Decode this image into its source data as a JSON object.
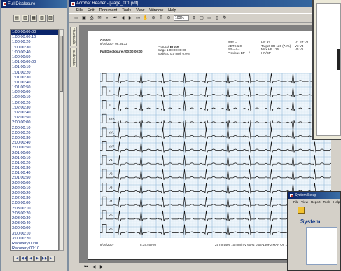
{
  "left_window": {
    "title": "Full Disclosure",
    "times": [
      "1:00:00:00:00",
      "1:00:00:00:10",
      "1:00:00:20",
      "1:00:00:30",
      "1:00:00:40",
      "1:00:00:50",
      "1:01:00:00:00",
      "1:01:00:10",
      "1:01:00:20",
      "1:01:00:30",
      "1:01:00:40",
      "1:01:00:50",
      "1:02:00:00",
      "1:02:00:10",
      "1:02:00:20",
      "1:02:00:30",
      "1:02:00:40",
      "1:02:00:50",
      "2:00:00:00",
      "2:00:00:10",
      "2:00:00:20",
      "2:00:00:30",
      "2:00:00:40",
      "2:00:00:50",
      "2:01:00:00",
      "2:01:00:10",
      "2:01:00:20",
      "2:01:00:30",
      "2:01:00:40",
      "2:01:00:50",
      "2:02:00:00",
      "2:02:00:10",
      "2:02:00:20",
      "2:02:00:30",
      "2:03:00:00",
      "2:03:00:10",
      "2:03:00:20",
      "2:03:00:30",
      "2:03:00:40",
      "3:00:00:00",
      "3:00:00:10",
      "3:00:00:20",
      "Recovery 00:00",
      "Recovery 00:10",
      "Recovery 00:20"
    ]
  },
  "acrobat": {
    "title": "Acrobat Reader - [Page_001.pdf]",
    "menu": [
      "File",
      "Edit",
      "Document",
      "Tools",
      "View",
      "Window",
      "Help"
    ],
    "zoom": "100%",
    "side_tabs": [
      "Thumbnails",
      "Bookmarks"
    ]
  },
  "report": {
    "name": "ASoon",
    "date_line": "8/16/2007 09:34:32",
    "header_label": "Full Disclosure / 00:00:00:00",
    "protocol": [
      [
        "Protocol",
        "Bruce"
      ],
      [
        "Stage",
        "1 00:00:00:00"
      ],
      [
        "Spd/Grd",
        "0.0 mph   0.0%"
      ]
    ],
    "vitals": [
      [
        "RPE",
        "--"
      ],
      [
        "METS",
        "1.0"
      ],
      [
        "BP",
        "---/---"
      ],
      [
        "Previous BP",
        "---/---"
      ]
    ],
    "hr": [
      [
        "HR",
        "93"
      ],
      [
        "Target HR",
        "126 (74%)"
      ],
      [
        "Max HR",
        "126"
      ],
      [
        "HR/BP",
        "---"
      ]
    ],
    "st_cols": [
      "V1 ST",
      "V2",
      "V3",
      "V4",
      "V5",
      "V6"
    ],
    "leads": [
      "I",
      "II",
      "III",
      "aVR",
      "aVL",
      "aVF",
      "V1",
      "V2",
      "V3",
      "V4",
      "V5",
      "V6"
    ],
    "footer_left": "8/16/2007",
    "footer_mid": "8:34:46 PM",
    "footer_right": "25 mm/sec  10 mm/mV  60Hz 0.04-150Hz  MAF  On  1/1"
  },
  "popup": {
    "title": "System Setup",
    "menu": [
      "File",
      "View",
      "Report",
      "Tools",
      "Help"
    ],
    "heading": "System"
  }
}
